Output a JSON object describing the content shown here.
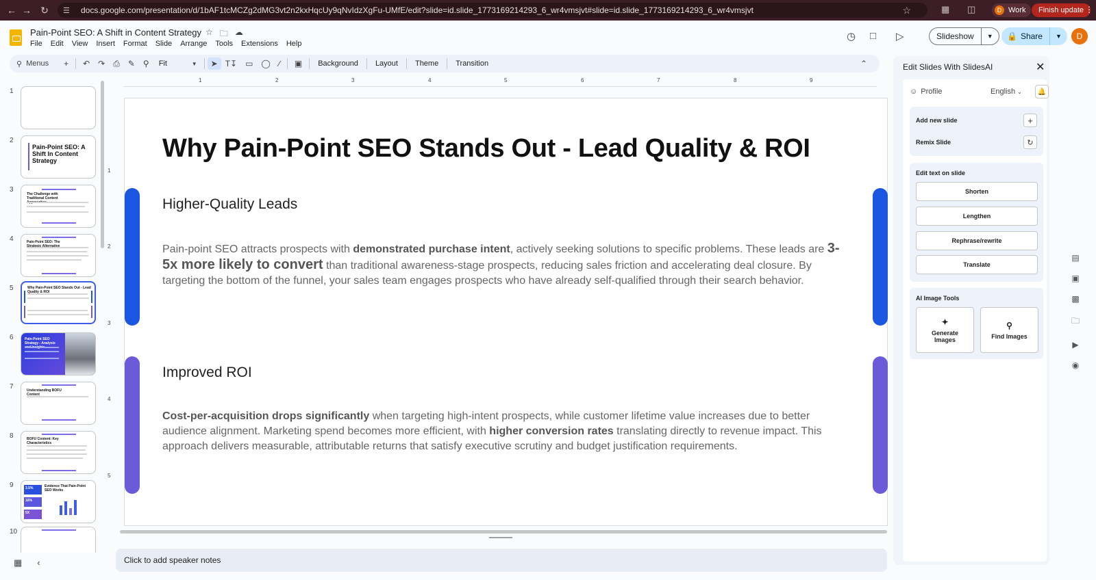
{
  "browser": {
    "url": "docs.google.com/presentation/d/1bAF1tcMCZg2dMG3vt2n2kxHqcUy9qNvIdzXgFu-UMfE/edit?slide=id.slide_1773169214293_6_wr4vmsjvt#slide=id.slide_1773169214293_6_wr4vmsjvt",
    "profile_label": "Work",
    "profile_initial": "D",
    "update_label": "Finish update"
  },
  "app": {
    "doc_title": "Pain-Point SEO: A Shift in Content Strategy",
    "menu": [
      "File",
      "Edit",
      "View",
      "Insert",
      "Format",
      "Slide",
      "Arrange",
      "Tools",
      "Extensions",
      "Help"
    ],
    "slideshow_label": "Slideshow",
    "share_label": "Share",
    "avatar_initial": "D"
  },
  "toolbar": {
    "menus_label": "Menus",
    "zoom_label": "Fit",
    "background_label": "Background",
    "layout_label": "Layout",
    "theme_label": "Theme",
    "transition_label": "Transition"
  },
  "filmstrip": {
    "numbers": [
      "1",
      "2",
      "3",
      "4",
      "5",
      "6",
      "7",
      "8",
      "9",
      "10"
    ],
    "slide2_title": "Pain-Point SEO: A Shift In Content Strategy",
    "slide3_title": "The Challenge with Traditional Content Approaches",
    "slide4_title": "Pain-Point SEO: The Strategic Alternative",
    "slide5_title": "Why Pain-Point SEO Stands Out - Lead Quality & ROI",
    "slide6_title": "Pain-Point SEO Strategy - Analysis and Insights",
    "slide7_title": "Understanding BOFU Content",
    "slide8_title": "BOFU Content: Key Characteristics",
    "slide9_title": "Evidence That Pain-Point SEO Works",
    "slide9_stats": [
      "3.5%",
      "16%",
      "5X"
    ]
  },
  "rulers": {
    "top": [
      "1",
      "2",
      "3",
      "4",
      "5",
      "6",
      "7",
      "8",
      "9"
    ],
    "left": [
      "1",
      "2",
      "3",
      "4",
      "5"
    ]
  },
  "slide": {
    "title": "Why Pain-Point SEO Stands Out - Lead Quality & ROI",
    "section1": {
      "heading": "Higher-Quality Leads",
      "p1": "Pain-point SEO attracts prospects with ",
      "b1": "demonstrated purchase intent",
      "p2": ", actively seeking solutions to specific problems. These leads are ",
      "b2": "3-5x more likely to convert",
      "p3": " than traditional awareness-stage prospects, reducing sales friction and accelerating deal closure. By targeting the bottom of the funnel, your sales team engages prospects who have already self-qualified through their search behavior."
    },
    "section2": {
      "heading": "Improved ROI",
      "b1": "Cost-per-acquisition drops significantly",
      "p1": " when targeting high-intent prospects, while customer lifetime value increases due to better audience alignment. Marketing spend becomes more efficient, with ",
      "b2": "higher conversion rates",
      "p2": " translating directly to revenue impact. This approach delivers measurable, attributable returns that satisfy executive scrutiny and budget justification requirements."
    },
    "colors": {
      "accent_blue": "#1a56e0",
      "accent_purple": "#6b5bd8"
    }
  },
  "notes": {
    "placeholder": "Click to add speaker notes"
  },
  "sidepanel": {
    "title": "Edit Slides With SlidesAI",
    "profile_label": "Profile",
    "language": "English",
    "add_new_slide": "Add new slide",
    "remix_slide": "Remix Slide",
    "edit_text_heading": "Edit text on slide",
    "shorten": "Shorten",
    "lengthen": "Lengthen",
    "rephrase": "Rephrase/rewrite",
    "translate": "Translate",
    "ai_image_heading": "AI Image Tools",
    "generate_images": "Generate Images",
    "find_images": "Find Images"
  }
}
